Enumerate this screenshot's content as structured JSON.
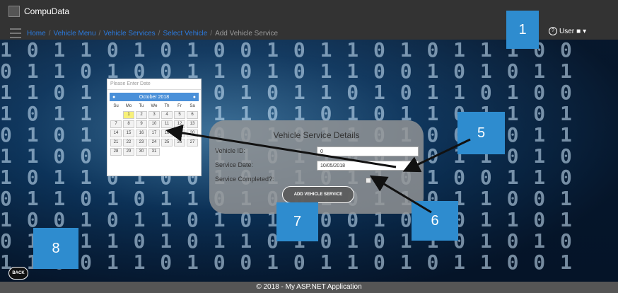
{
  "app": {
    "title": "CompuData"
  },
  "breadcrumbs": [
    "Home",
    "Vehicle Menu",
    "Vehicle Services",
    "Select Vehicle",
    "Add Vehicle Service"
  ],
  "user": {
    "label": "User"
  },
  "callouts": [
    "1",
    "5",
    "6",
    "7",
    "8"
  ],
  "calendar": {
    "placeholder": "Please Enter Date",
    "month_label": "October 2018",
    "weekdays": [
      "Su",
      "Mo",
      "Tu",
      "We",
      "Th",
      "Fr",
      "Sa"
    ],
    "weeks": [
      [
        "",
        "1",
        "2",
        "3",
        "4",
        "5",
        "6"
      ],
      [
        "7",
        "8",
        "9",
        "10",
        "11",
        "12",
        "13"
      ],
      [
        "14",
        "15",
        "16",
        "17",
        "18",
        "19",
        "20"
      ],
      [
        "21",
        "22",
        "23",
        "24",
        "25",
        "26",
        "27"
      ],
      [
        "28",
        "29",
        "30",
        "31",
        "",
        "",
        ""
      ]
    ],
    "highlighted_day": "1"
  },
  "form": {
    "title": "Vehicle Service Details",
    "vehicle_id_label": "Vehicle ID:",
    "vehicle_id_value": "0",
    "service_date_label": "Service Date:",
    "service_date_value": "10/05/2018",
    "service_completed_label": "Service Completed?:",
    "add_button": "ADD VEHICLE SERVICE"
  },
  "back_button": "BACK",
  "footer": "© 2018 - My ASP.NET Application",
  "colors": {
    "callout": "#2e8ccf",
    "link": "#2a7be0",
    "navbar": "#333333"
  }
}
